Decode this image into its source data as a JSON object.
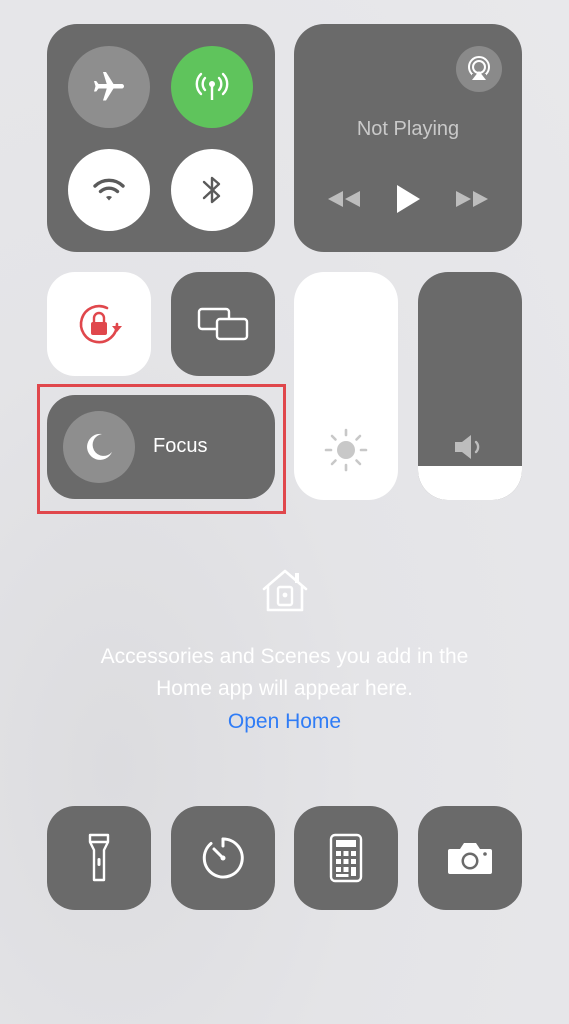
{
  "connectivity": {
    "airplane_mode": "off",
    "cellular_data": "on",
    "wifi": "on",
    "bluetooth": "on"
  },
  "media": {
    "status": "Not Playing"
  },
  "sliders": {
    "brightness_level": 1.0,
    "volume_level": 0.15
  },
  "focus": {
    "label": "Focus"
  },
  "home": {
    "message_line1": "Accessories and Scenes you add in the",
    "message_line2": "Home app will appear here.",
    "open_link": "Open Home"
  },
  "colors": {
    "tile": "#6a6a6a",
    "cellular_active": "#5fc45c",
    "rotation_lock_red": "#e0474c",
    "link_blue": "#2f7cf6",
    "highlight_red": "#e0474c"
  },
  "icons": {
    "airplane": "airplane-icon",
    "cellular": "antenna-icon",
    "wifi": "wifi-icon",
    "bluetooth": "bluetooth-icon",
    "airplay": "airplay-icon",
    "rotation_lock": "rotation-lock-icon",
    "screen_mirror": "screen-mirroring-icon",
    "brightness": "sun-icon",
    "volume": "speaker-icon",
    "focus": "moon-icon",
    "home": "house-icon",
    "flashlight": "flashlight-icon",
    "timer": "timer-icon",
    "calculator": "calculator-icon",
    "camera": "camera-icon"
  }
}
